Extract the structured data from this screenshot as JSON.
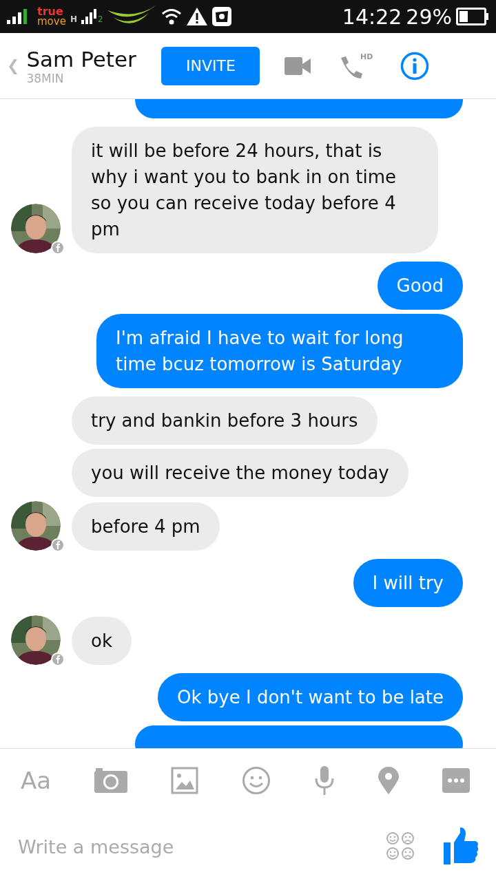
{
  "status_bar": {
    "carrier_top": "true",
    "carrier_bottom": "move",
    "network": "H",
    "sim": "2",
    "time": "14:22",
    "battery": "29%"
  },
  "header": {
    "back": "❮",
    "name": "Sam Peter",
    "status": "38MIN",
    "invite": "INVITE",
    "call_badge": "HD"
  },
  "messages": [
    {
      "outgoing": true,
      "kind": "clipped",
      "avatar": false
    },
    {
      "outgoing": false,
      "kind": "text",
      "text": "it will be before 24 hours, that is why i want you to bank in on time so you can receive today before 4 pm",
      "avatar": true
    },
    {
      "outgoing": true,
      "kind": "text",
      "text": "Good",
      "avatar": false
    },
    {
      "outgoing": true,
      "kind": "text",
      "text": "I'm afraid I have to wait for long time bcuz tomorrow is Saturday",
      "avatar": false
    },
    {
      "outgoing": false,
      "kind": "text",
      "text": "try and bankin before 3 hours",
      "avatar": false
    },
    {
      "outgoing": false,
      "kind": "text",
      "text": "you will receive the money today",
      "avatar": false
    },
    {
      "outgoing": false,
      "kind": "text",
      "text": "before 4 pm",
      "avatar": true
    },
    {
      "outgoing": true,
      "kind": "text",
      "text": "I will try",
      "avatar": false
    },
    {
      "outgoing": false,
      "kind": "text",
      "text": "ok",
      "avatar": true
    },
    {
      "outgoing": true,
      "kind": "text",
      "text": "Ok bye I don't want to be late",
      "avatar": false
    },
    {
      "outgoing": true,
      "kind": "clipped",
      "avatar": false
    }
  ],
  "composer": {
    "font_toggle": "Aa",
    "placeholder": "Write a message"
  }
}
